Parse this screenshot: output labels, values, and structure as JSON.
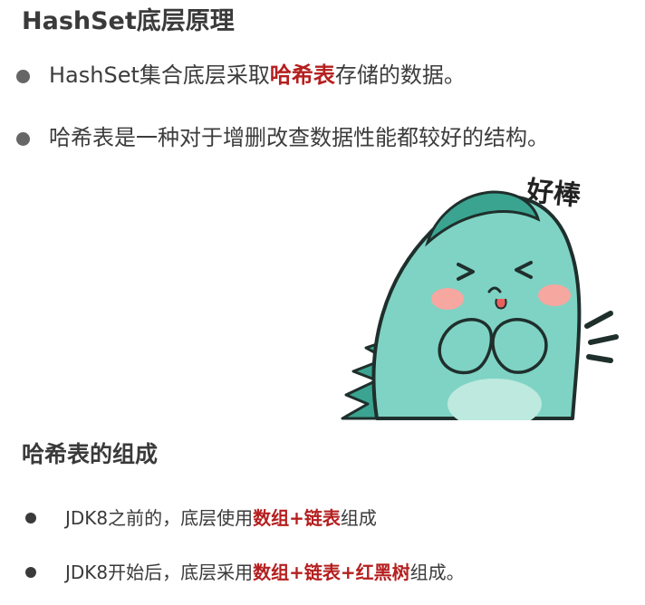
{
  "heading": "HashSet底层原理",
  "bullets": [
    {
      "before": "HashSet集合底层采取",
      "highlight": "哈希表",
      "after": "存储的数据。"
    },
    {
      "text": "哈希表是一种对于增删改查数据性能都较好的结构。"
    }
  ],
  "sticker": {
    "caption": "好棒"
  },
  "section2": {
    "heading": "哈希表的组成",
    "items": [
      {
        "before": "JDK8之前的，底层使用",
        "highlight": "数组+链表",
        "after": "组成"
      },
      {
        "before": "JDK8开始后，底层采用",
        "highlight": "数组+链表+红黑树",
        "after": "组成。"
      }
    ]
  },
  "colors": {
    "highlight": "#b51f1f",
    "dino": "#7fd3c4",
    "dino_dark": "#3aa491",
    "cheek": "#f6a7a0"
  }
}
